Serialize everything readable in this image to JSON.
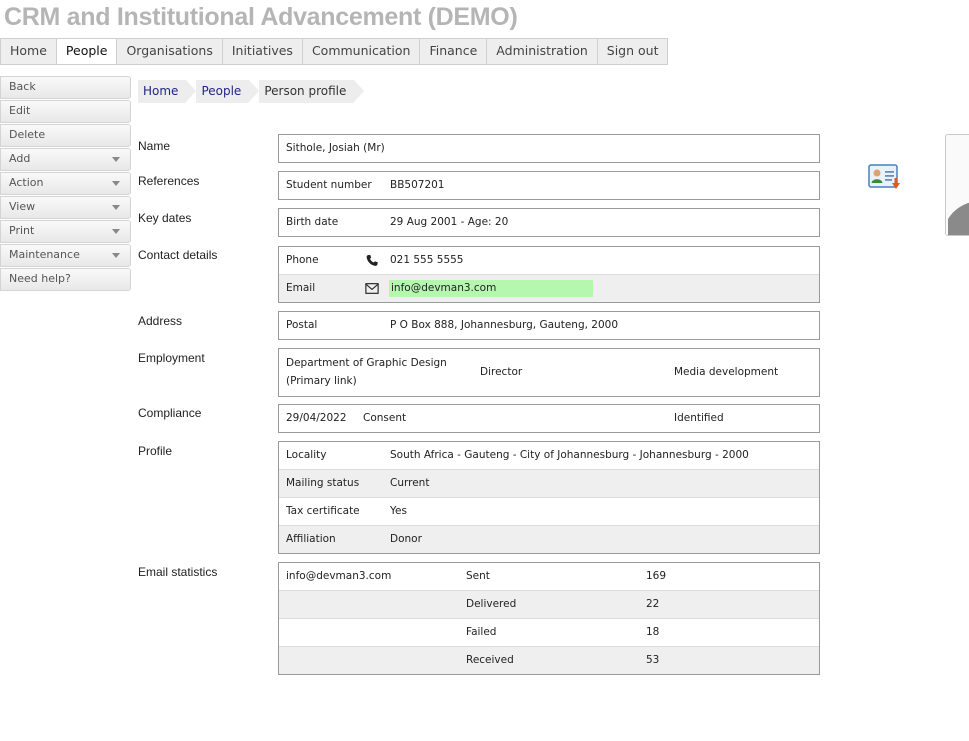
{
  "app": {
    "title": "CRM and Institutional Advancement (DEMO)"
  },
  "topnav": {
    "tabs": [
      {
        "label": "Home"
      },
      {
        "label": "People"
      },
      {
        "label": "Organisations"
      },
      {
        "label": "Initiatives"
      },
      {
        "label": "Communication"
      },
      {
        "label": "Finance"
      },
      {
        "label": "Administration"
      },
      {
        "label": "Sign out"
      }
    ],
    "active": "People"
  },
  "sidemenu": {
    "items": [
      {
        "label": "Back"
      },
      {
        "label": "Edit"
      },
      {
        "label": "Delete"
      },
      {
        "label": "Add"
      },
      {
        "label": "Action"
      },
      {
        "label": "View"
      },
      {
        "label": "Print"
      },
      {
        "label": "Maintenance"
      },
      {
        "label": "Need help?"
      }
    ]
  },
  "breadcrumb": {
    "items": [
      "Home",
      "People",
      "Person profile"
    ]
  },
  "sections": {
    "name": {
      "label": "Name",
      "value": "Sithole, Josiah (Mr)"
    },
    "references": {
      "label": "References",
      "field": "Student number",
      "value": "BB507201"
    },
    "key_dates": {
      "label": "Key dates",
      "field": "Birth date",
      "value": "29 Aug 2001 - Age: 20"
    },
    "contact": {
      "label": "Contact details",
      "phone_label": "Phone",
      "phone_value": "021 555 5555",
      "email_label": "Email",
      "email_value": "info@devman3.com"
    },
    "address": {
      "label": "Address",
      "field": "Postal",
      "value": "P O Box 888, Johannesburg, Gauteng, 2000"
    },
    "employment": {
      "label": "Employment",
      "department": "Department of Graphic Design",
      "link": "(Primary link)",
      "position": "Director",
      "area": "Media development"
    },
    "compliance": {
      "label": "Compliance",
      "date": "29/04/2022",
      "type": "Consent",
      "status": "Identified"
    },
    "profile": {
      "label": "Profile",
      "rows": [
        {
          "field": "Locality",
          "value": "South Africa - Gauteng - City of Johannesburg - Johannesburg - 2000"
        },
        {
          "field": "Mailing status",
          "value": "Current"
        },
        {
          "field": "Tax certificate",
          "value": "Yes"
        },
        {
          "field": "Affiliation",
          "value": "Donor"
        }
      ]
    },
    "email_stats": {
      "label": "Email statistics",
      "address": "info@devman3.com",
      "rows": [
        {
          "metric": "Sent",
          "count": "169"
        },
        {
          "metric": "Delivered",
          "count": "22"
        },
        {
          "metric": "Failed",
          "count": "18"
        },
        {
          "metric": "Received",
          "count": "53"
        }
      ]
    }
  },
  "icons": {
    "phone": "phone-icon",
    "email": "envelope-icon",
    "contact_card": "contact-card-download-icon"
  },
  "colors": {
    "email_highlight": "#b6f7b0",
    "breadcrumb_link": "#23238c"
  }
}
